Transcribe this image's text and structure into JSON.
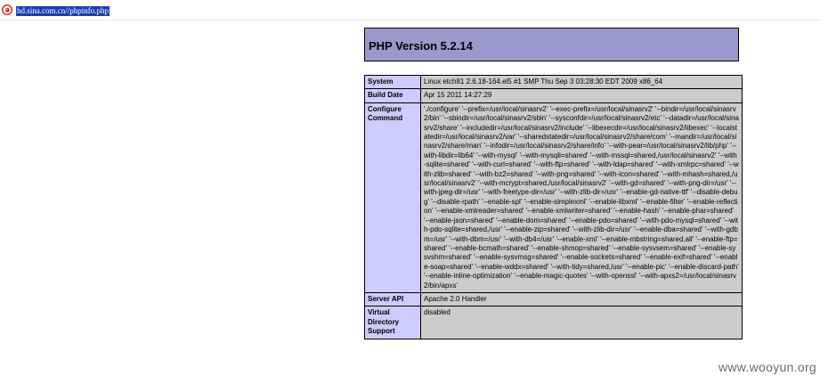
{
  "browser": {
    "favicon": "sina-favicon",
    "url": "hd.sina.com.cn//phpinfo.php"
  },
  "header": {
    "title": "PHP Version 5.2.14"
  },
  "rows": [
    {
      "key": "System",
      "value": "Linux etch81 2.6.18-164.el5 #1 SMP Thu Sep 3 03:28:30 EDT 2009 x86_64"
    },
    {
      "key": "Build Date",
      "value": "Apr 15 2011 14:27:29"
    },
    {
      "key": "Configure Command",
      "value": "'./configure' '--prefix=/usr/local/sinasrv2' '--exec-prefix=/usr/local/sinasrv2' '--bindir=/usr/local/sinasrv2/bin' '--sbindir=/usr/local/sinasrv2/sbin' '--sysconfdir=/usr/local/sinasrv2/etc' '--datadir=/usr/local/sinasrv2/share' '--includedir=/usr/local/sinasrv2/include' '--libexecdir=/usr/local/sinasrv2/libexec' '--localstatedir=/usr/local/sinasrv2/var' '--sharedstatedir=/usr/local/sinasrv2/share/com' '--mandir=/usr/local/sinasrv2/share/man' '--infodir=/usr/local/sinasrv2/share/info' '--with-pear=/usr/local/sinasrv2/lib/php' '--with-libdir=lib64' '--with-mysql' '--with-mysqli=shared' '--with-mssql=shared,/usr/local/sinasrv2' '--with-sqlite=shared' '--with-curl=shared' '--with-ftp=shared' '--with-ldap=shared' '--with-xmlrpc=shared' '--with-zlib=shared' '--with-bz2=shared' '--with-png=shared' '--with-icon=shared' '--with-mhash=shared,/usr/local/sinasrv2' '--with-mcrypt=shared,/usr/local/sinasrv2' '--with-gd=shared' '--with-png-dir=/usr' '--with-jpeg-dir=/usr' '--with-freetype-dir=/usr' '--with-zlib-dir=/usr' '--enable-gd-native-ttf' '--disable-debug' '--disable-rpath' '--enable-spl' '--enable-simplexml' '--enable-libxml' '--enable-filter' '--enable-reflection' '--enable-xmlreader=shared' '--enable-xmlwriter=shared' '--enable-hash' '--enable-phar=shared' '--enable-json=shared' '--enable-dom=shared' '--enable-pdo=shared' '--with-pdo-mysql=shared' '--with-pdo-sqlite=shared,/usr' '--enable-zip=shared' '--with-zlib-dir=/usr' '--enable-dba=shared' '--with-gdbm=/usr' '--with-dbm=/usr' '--with-db4=/usr' '--enable-xml' '--enable-mbstring=shared,all' '--enable-ftp=shared' '--enable-bcmath=shared' '--enable-shmop=shared' '--enable-sysvsem=shared' '--enable-sysvshm=shared' '--enable-sysvmsg=shared' '--enable-sockets=shared' '--enable-exif=shared' '--enable-soap=shared' '--enable-wddx=shared' '--with-tidy=shared,/usr' '--enable-pic' '--enable-discard-path' '--enable-inline-optimization' '--enable-magic-quotes' '--with-openssl' '--with-apxs2=/usr/local/sinasrv2/bin/apxs'"
    },
    {
      "key": "Server API",
      "value": "Apache 2.0 Handler"
    },
    {
      "key": "Virtual Directory Support",
      "value": "disabled"
    }
  ],
  "watermark": "www.wooyun.org",
  "colors": {
    "header_bg": "#9999cc",
    "key_bg": "#ccccff",
    "value_bg": "#cccccc",
    "url_highlight": "#1b3fb0"
  }
}
